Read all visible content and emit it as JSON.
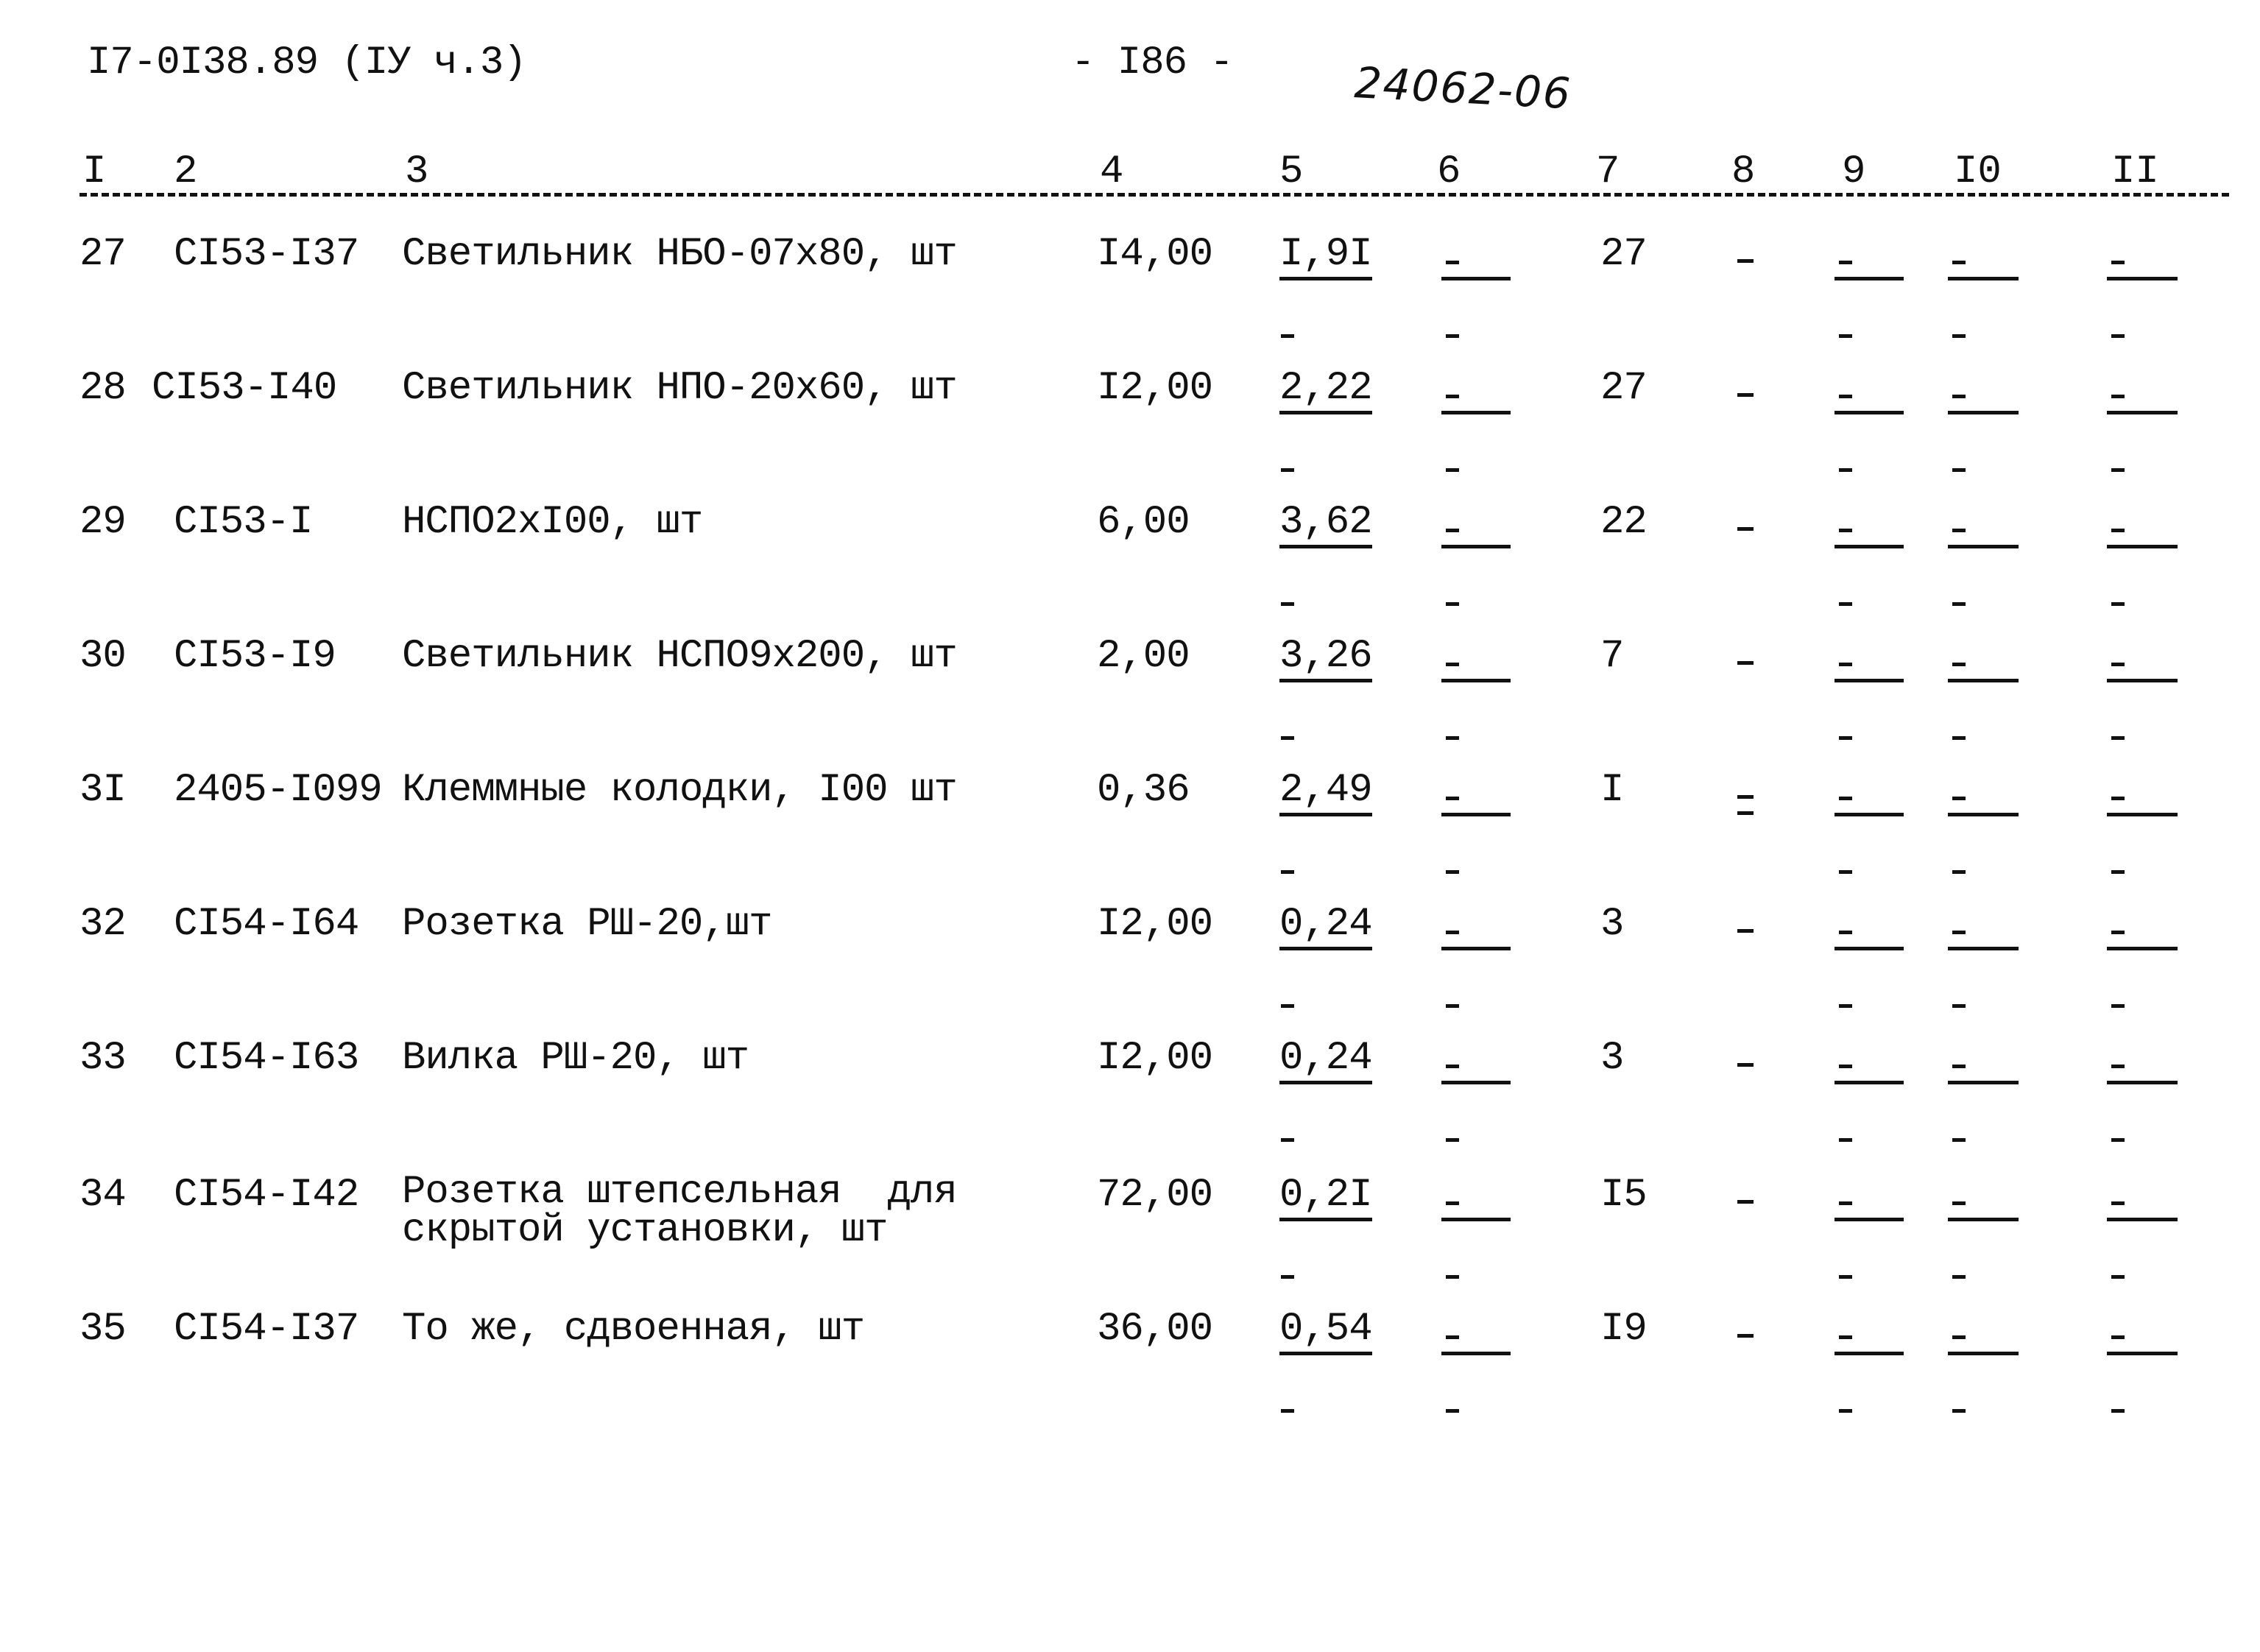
{
  "header": {
    "doc_code": "I7-0I38.89 (IУ ч.3)",
    "page_number": "- I86 -",
    "handwritten_mark": "24062-06"
  },
  "column_numbers": [
    "I",
    "2",
    "3",
    "4",
    "5",
    "6",
    "7",
    "8",
    "9",
    "I0",
    "II"
  ],
  "rows": [
    {
      "num": "27",
      "code": "CI53-I37",
      "desc": [
        "Светильник НБО-07х80, шт"
      ],
      "qty": "I4,00",
      "col5": "I,9I",
      "col5_below": "-",
      "col6": "-",
      "col7": "27",
      "col8": "-",
      "col9": "-",
      "col10": "-",
      "col11": "-"
    },
    {
      "num": "28",
      "code": "CI53-I40",
      "desc": [
        "Светильник НПО-20х60, шт"
      ],
      "qty": "I2,00",
      "col5": "2,22",
      "col5_below": "-",
      "col6": "-",
      "col7": "27",
      "col8": "-",
      "col9": "-",
      "col10": "-",
      "col11": "-"
    },
    {
      "num": "29",
      "code": "CI53-I",
      "desc": [
        "НСПО2хI00, шт"
      ],
      "qty": "6,00",
      "col5": "3,62",
      "col5_below": "-",
      "col6": "-",
      "col7": "22",
      "col8": "-",
      "col9": "-",
      "col10": "-",
      "col11": "-"
    },
    {
      "num": "30",
      "code": "CI53-I9",
      "desc": [
        "Светильник НСПО9х200, шт"
      ],
      "qty": "2,00",
      "col5": "3,26",
      "col5_below": "-",
      "col6": "-",
      "col7": "7",
      "col8": "-",
      "col9": "-",
      "col10": "-",
      "col11": "-"
    },
    {
      "num": "3I",
      "code": "2405-I099",
      "desc": [
        "Клеммные колодки, I00 шт"
      ],
      "qty": "0,36",
      "col5": "2,49",
      "col5_below": "-",
      "col6": "-",
      "col7": "I",
      "col8": "=",
      "col9": "-",
      "col10": "-",
      "col11": "-"
    },
    {
      "num": "32",
      "code": "CI54-I64",
      "desc": [
        "Розетка РШ-20,шт"
      ],
      "qty": "I2,00",
      "col5": "0,24",
      "col5_below": "-",
      "col6": "-",
      "col7": "3",
      "col8": "-",
      "col9": "-",
      "col10": "-",
      "col11": "-"
    },
    {
      "num": "33",
      "code": "CI54-I63",
      "desc": [
        "Вилка РШ-20, шт"
      ],
      "qty": "I2,00",
      "col5": "0,24",
      "col5_below": "-",
      "col6": "-",
      "col7": "3",
      "col8": "-",
      "col9": "-",
      "col10": "-",
      "col11": "-"
    },
    {
      "num": "34",
      "code": "CI54-I42",
      "desc": [
        "Розетка штепсельная  для",
        "скрытой установки, шт"
      ],
      "qty": "72,00",
      "col5": "0,2I",
      "col5_below": "-",
      "col6": "-",
      "col7": "I5",
      "col8": "-",
      "col9": "-",
      "col10": "-",
      "col11": "-"
    },
    {
      "num": "35",
      "code": "CI54-I37",
      "desc": [
        "То же, сдвоенная, шт"
      ],
      "qty": "36,00",
      "col5": "0,54",
      "col5_below": "-",
      "col6": "-",
      "col7": "I9",
      "col8": "-",
      "col9": "-",
      "col10": "-",
      "col11": "-"
    }
  ]
}
